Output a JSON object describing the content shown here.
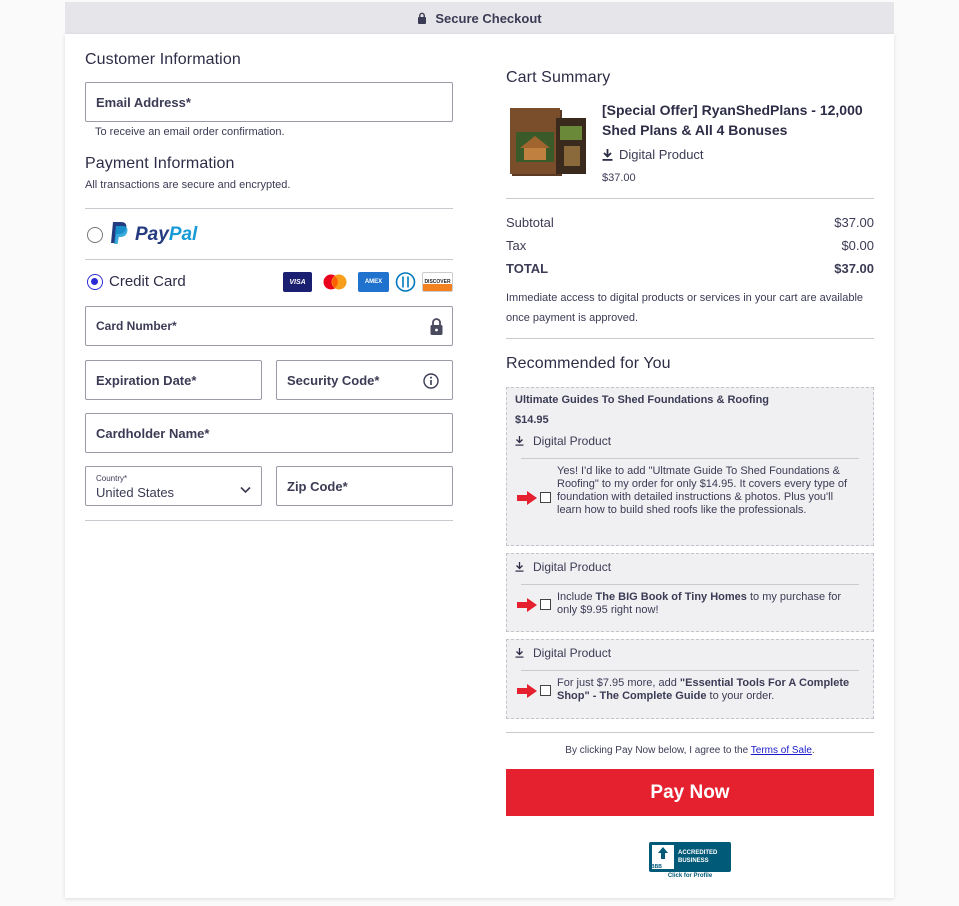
{
  "header": {
    "title": "Secure Checkout"
  },
  "customer": {
    "heading": "Customer Information",
    "email_label": "Email Address*",
    "email_hint": "To receive an email order confirmation."
  },
  "payment": {
    "heading": "Payment Information",
    "subtext": "All transactions are secure and encrypted.",
    "paypal_pay": "Pay",
    "paypal_pal": "Pal",
    "credit_card_label": "Credit Card",
    "card_logos": [
      "VISA",
      "Mastercard",
      "AMEX",
      "Diners",
      "DISCOVER"
    ],
    "card_number_label": "Card Number*",
    "expiration_label": "Expiration Date*",
    "security_code_label": "Security Code*",
    "cardholder_label": "Cardholder Name*",
    "country_small_label": "Country*",
    "country_value": "United States",
    "zip_label": "Zip Code*"
  },
  "cart": {
    "heading": "Cart Summary",
    "product_title": "[Special Offer] RyanShedPlans - 12,000 Shed Plans & All 4 Bonuses",
    "product_type": "Digital Product",
    "product_price": "$37.00",
    "subtotal_label": "Subtotal",
    "subtotal_value": "$37.00",
    "tax_label": "Tax",
    "tax_value": "$0.00",
    "total_label": "TOTAL",
    "total_value": "$37.00",
    "access_note": "Immediate access to digital products or services in your cart are available once payment is approved."
  },
  "recommended": {
    "heading": "Recommended for You",
    "offers": [
      {
        "title": "Ultimate Guides To Shed Foundations & Roofing",
        "price": "$14.95",
        "type": "Digital Product",
        "text": "Yes! I'd like to add \"Ultmate Guide To Shed Foundations & Roofing\" to my order for only $14.95. It covers every type of foundation with detailed instructions & photos. Plus you'll learn how to build shed roofs like the professionals."
      },
      {
        "type": "Digital Product",
        "text_pre": "Include ",
        "text_bold": "The BIG Book of Tiny Homes",
        "text_post": " to my purchase for only $9.95 right now!"
      },
      {
        "type": "Digital Product",
        "text_pre": "For just $7.95 more, add ",
        "text_bold": "\"Essential Tools For A Complete Shop\" - The Complete Guide",
        "text_post": " to your order."
      }
    ]
  },
  "footer": {
    "agree_pre": "By clicking Pay Now below, I agree to the ",
    "terms_link": "Terms of Sale",
    "agree_post": ".",
    "pay_button": "Pay Now",
    "bbb_line1": "ACCREDITED",
    "bbb_line2": "BUSINESS",
    "bbb_click": "Click for Profile",
    "bbb_mark": "BBB"
  },
  "colors": {
    "accent_blue": "#2b2bd6",
    "pay_red": "#e5202f",
    "paypal_dark": "#253b80",
    "paypal_light": "#179bd7"
  }
}
